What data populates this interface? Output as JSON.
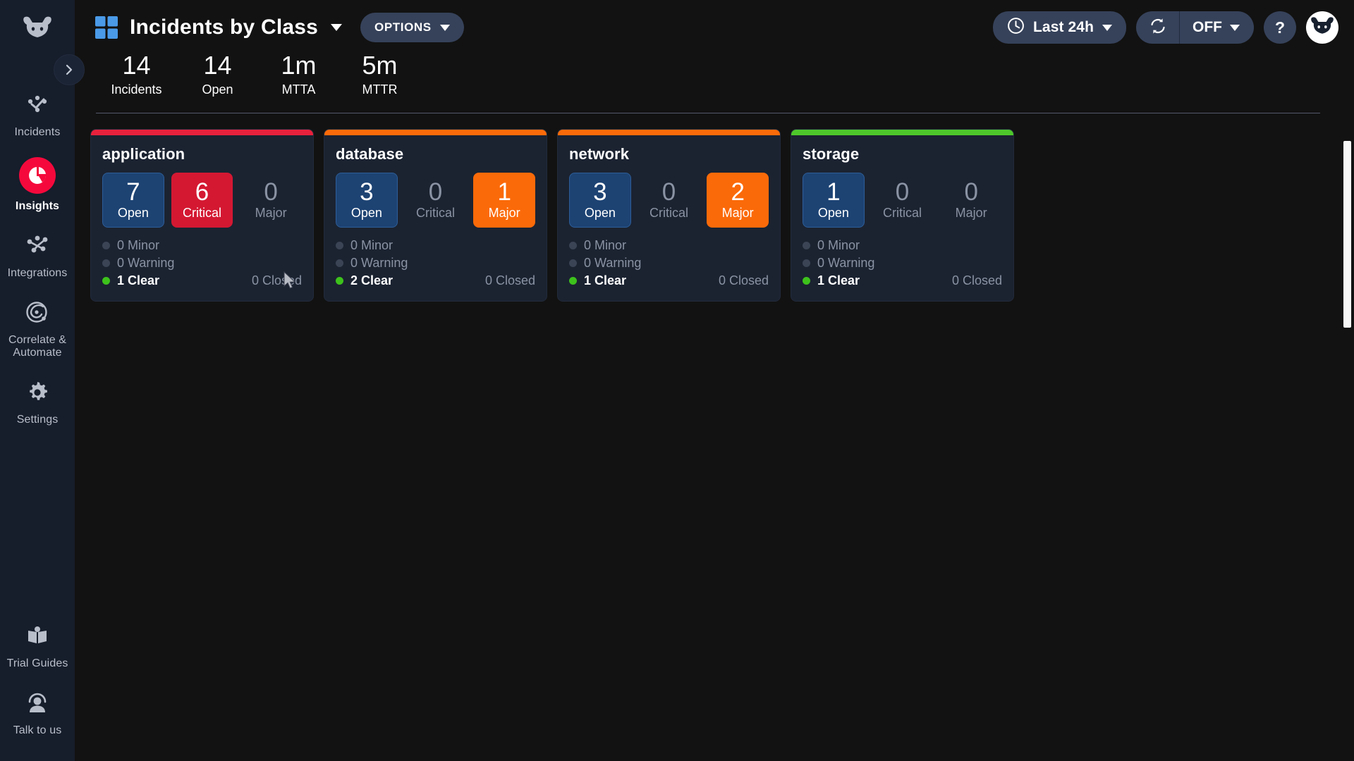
{
  "sidebar": {
    "logo_icon": "moogsoft-cow-logo",
    "expand_icon": "chevron-right-icon",
    "items": [
      {
        "label": "Incidents",
        "icon": "incidents-nodes-icon",
        "active": false
      },
      {
        "label": "Insights",
        "icon": "insights-pie-chart-icon",
        "active": true
      },
      {
        "label": "Integrations",
        "icon": "integrations-network-icon",
        "active": false
      },
      {
        "label": "Correlate & Automate",
        "icon": "correlate-target-icon",
        "active": false
      },
      {
        "label": "Settings",
        "icon": "gear-icon",
        "active": false
      }
    ],
    "bottom_items": [
      {
        "label": "Trial Guides",
        "icon": "open-book-icon"
      },
      {
        "label": "Talk to us",
        "icon": "support-agent-icon"
      }
    ]
  },
  "header": {
    "grid_icon": "grid-squares-icon",
    "title": "Incidents by Class",
    "title_caret_icon": "chevron-down-icon",
    "options_label": "OPTIONS",
    "options_caret_icon": "chevron-down-icon",
    "time_range": "Last 24h",
    "time_icon": "clock-icon",
    "time_caret_icon": "chevron-down-icon",
    "refresh_icon": "refresh-icon",
    "autorefresh_label": "OFF",
    "autorefresh_caret_icon": "chevron-down-icon",
    "help_label": "?",
    "avatar_icon": "moogsoft-cow-avatar"
  },
  "stats": [
    {
      "value": "14",
      "label": "Incidents"
    },
    {
      "value": "14",
      "label": "Open"
    },
    {
      "value": "1m",
      "label": "MTTA"
    },
    {
      "value": "5m",
      "label": "MTTR"
    }
  ],
  "closed_label": "0 Closed",
  "colors": {
    "critical": "#d41832",
    "major": "#fb6a09",
    "clear": "#3dc21c",
    "open": "#1d4373",
    "accent": "#f5093c"
  },
  "cards": [
    {
      "title": "application",
      "top_color": "#e8213c",
      "open": {
        "value": "7",
        "label": "Open",
        "state": "open"
      },
      "critical": {
        "value": "6",
        "label": "Critical",
        "state": "critical"
      },
      "major": {
        "value": "0",
        "label": "Major",
        "state": "zero"
      },
      "minor": {
        "value": "0 Minor",
        "state": "off"
      },
      "warning": {
        "value": "0 Warning",
        "state": "off"
      },
      "clear": {
        "value": "1 Clear",
        "state": "clear"
      },
      "closed": "0 Closed"
    },
    {
      "title": "database",
      "top_color": "#fb6a09",
      "open": {
        "value": "3",
        "label": "Open",
        "state": "open"
      },
      "critical": {
        "value": "0",
        "label": "Critical",
        "state": "zero"
      },
      "major": {
        "value": "1",
        "label": "Major",
        "state": "major"
      },
      "minor": {
        "value": "0 Minor",
        "state": "off"
      },
      "warning": {
        "value": "0 Warning",
        "state": "off"
      },
      "clear": {
        "value": "2 Clear",
        "state": "clear"
      },
      "closed": "0 Closed"
    },
    {
      "title": "network",
      "top_color": "#fb6a09",
      "open": {
        "value": "3",
        "label": "Open",
        "state": "open"
      },
      "critical": {
        "value": "0",
        "label": "Critical",
        "state": "zero"
      },
      "major": {
        "value": "2",
        "label": "Major",
        "state": "major"
      },
      "minor": {
        "value": "0 Minor",
        "state": "off"
      },
      "warning": {
        "value": "0 Warning",
        "state": "off"
      },
      "clear": {
        "value": "1 Clear",
        "state": "clear"
      },
      "closed": "0 Closed"
    },
    {
      "title": "storage",
      "top_color": "#4ec72b",
      "open": {
        "value": "1",
        "label": "Open",
        "state": "open"
      },
      "critical": {
        "value": "0",
        "label": "Critical",
        "state": "zero"
      },
      "major": {
        "value": "0",
        "label": "Major",
        "state": "zero"
      },
      "minor": {
        "value": "0 Minor",
        "state": "off"
      },
      "warning": {
        "value": "0 Warning",
        "state": "off"
      },
      "clear": {
        "value": "1 Clear",
        "state": "clear"
      },
      "closed": "0 Closed"
    }
  ]
}
